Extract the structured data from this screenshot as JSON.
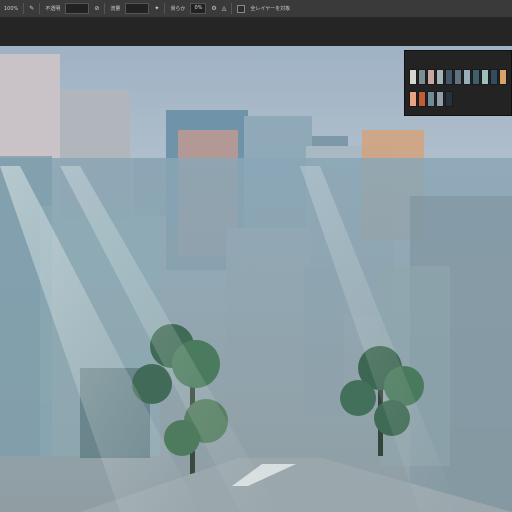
{
  "options_bar": {
    "zoom": "100%",
    "opacity_label": "不透明",
    "flow_label": "流量",
    "smoothing_label": "滑らか",
    "smoothing_value": "0%",
    "sample_all_layers_label": "全レイヤーを対象"
  },
  "palette": {
    "row1": [
      "#d7d7d0",
      "#7d8d96",
      "#c9a7a1",
      "#a6b2ba",
      "#44586a",
      "#5f7383",
      "#9aaeba",
      "#3f5f69",
      "#9ec0bd",
      "#314d5f",
      "#d9a36a"
    ],
    "row2": [
      "#e8a483",
      "#bf5d35",
      "#6e8d99",
      "#8f9ea7",
      "#23323b"
    ]
  }
}
